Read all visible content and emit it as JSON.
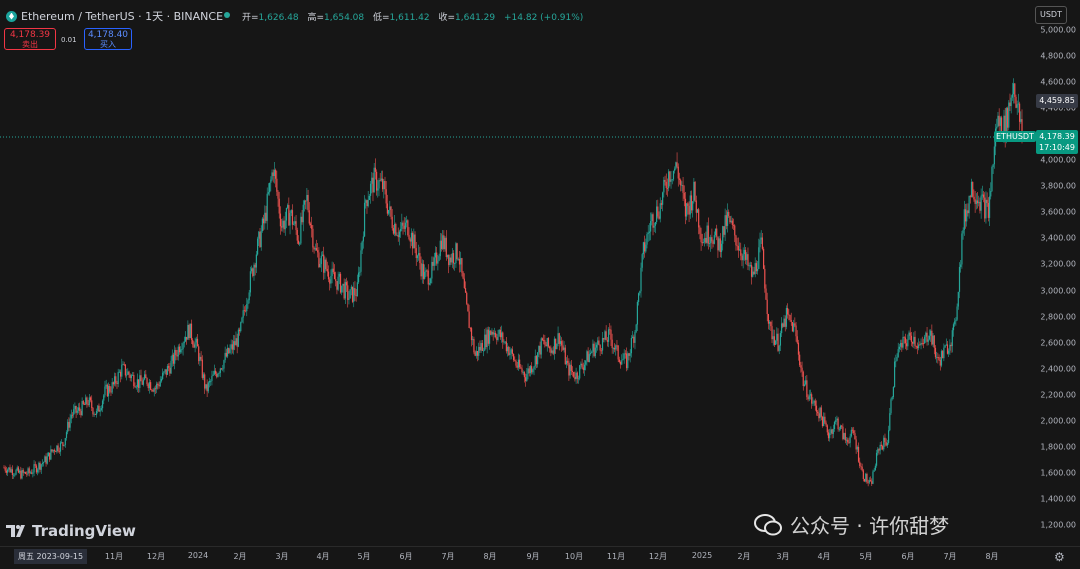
{
  "header": {
    "symbol": "Ethereum / TetherUS · 1天 · BINANCE",
    "open_label": "开=",
    "open": "1,626.48",
    "high_label": "高=",
    "high": "1,654.08",
    "low_label": "低=",
    "low": "1,611.42",
    "close_label": "收=",
    "close": "1,641.29",
    "change": "+14.82 (+0.91%)"
  },
  "trade": {
    "sell_price": "4,178.39",
    "sell_label": "卖出",
    "spread": "0.01",
    "buy_price": "4,178.40",
    "buy_label": "买入"
  },
  "currency": "USDT",
  "price_badges": {
    "symbol": "ETHUSDT",
    "last": "4,178.39",
    "countdown": "17:10:49",
    "high_marker": "4,459.85"
  },
  "y_ticks": [
    "5,000.00",
    "4,800.00",
    "4,600.00",
    "4,400.00",
    "4,200.00",
    "4,000.00",
    "3,800.00",
    "3,600.00",
    "3,400.00",
    "3,200.00",
    "3,000.00",
    "2,800.00",
    "2,600.00",
    "2,400.00",
    "2,200.00",
    "2,000.00",
    "1,800.00",
    "1,600.00",
    "1,400.00",
    "1,200.00"
  ],
  "x_ticks": [
    "11月",
    "12月",
    "2024",
    "2月",
    "3月",
    "4月",
    "5月",
    "6月",
    "7月",
    "8月",
    "9月",
    "10月",
    "11月",
    "12月",
    "2025",
    "2月",
    "3月",
    "4月",
    "5月",
    "6月",
    "7月",
    "8月"
  ],
  "date_badge": "周五 2023-09-15",
  "logo_text": "TradingView",
  "watermark": "公众号 · 许你甜梦",
  "colors": {
    "up": "#26a69a",
    "down": "#ef5350",
    "bg": "#161616"
  },
  "chart_data": {
    "type": "candlestick",
    "ylim": [
      1200,
      5000
    ],
    "x_start": "2023-09-15",
    "x_end": "2025-08-28",
    "series": [
      {
        "name": "ETHUSDT",
        "close": [
          1641,
          1620,
          1590,
          1600,
          1650,
          1700,
          1790,
          1820,
          2050,
          2080,
          2150,
          2050,
          2220,
          2270,
          2400,
          2350,
          2290,
          2310,
          2250,
          2350,
          2450,
          2600,
          2700,
          2550,
          2230,
          2350,
          2450,
          2550,
          2650,
          3000,
          3300,
          3550,
          3950,
          3500,
          3600,
          3400,
          3700,
          3300,
          3200,
          3100,
          3050,
          2950,
          3000,
          3700,
          3850,
          3800,
          3550,
          3450,
          3500,
          3300,
          3100,
          3150,
          3400,
          3250,
          3300,
          2850,
          2500,
          2600,
          2700,
          2650,
          2550,
          2420,
          2350,
          2450,
          2600,
          2550,
          2650,
          2400,
          2350,
          2450,
          2550,
          2600,
          2650,
          2500,
          2450,
          2700,
          3300,
          3550,
          3650,
          3900,
          3950,
          3600,
          3750,
          3400,
          3450,
          3350,
          3550,
          3400,
          3250,
          3100,
          3350,
          2700,
          2600,
          2800,
          2700,
          2300,
          2150,
          2050,
          1900,
          2000,
          1850,
          1900,
          1600,
          1500,
          1800,
          1850,
          2500,
          2600,
          2650,
          2550,
          2700,
          2450,
          2550,
          2700,
          3500,
          3800,
          3700,
          3600,
          4300,
          4250,
          4600,
          4180
        ]
      }
    ]
  }
}
